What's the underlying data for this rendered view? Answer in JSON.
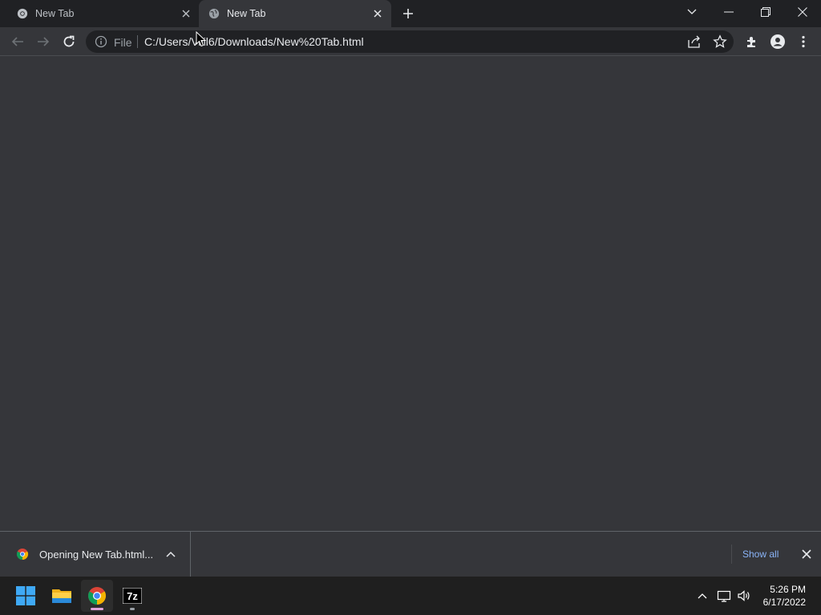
{
  "tabs": [
    {
      "title": "New Tab",
      "favicon": "chrome-logo-icon",
      "active": false
    },
    {
      "title": "New Tab",
      "favicon": "globe-icon",
      "active": true
    }
  ],
  "toolbar": {
    "security_label": "File",
    "url": "C:/Users/Vilil6/Downloads/New%20Tab.html"
  },
  "download_shelf": {
    "item_label": "Opening New Tab.html...",
    "show_all_label": "Show all"
  },
  "taskbar": {
    "apps": [
      "windows-start-icon",
      "file-explorer-icon",
      "chrome-icon",
      "7zip-icon"
    ],
    "time": "5:26 PM",
    "date": "6/17/2022"
  },
  "colors": {
    "frame": "#202124",
    "toolbar": "#35363a",
    "accent_link": "#8ab4f8",
    "taskbar": "#1f1f1f"
  }
}
